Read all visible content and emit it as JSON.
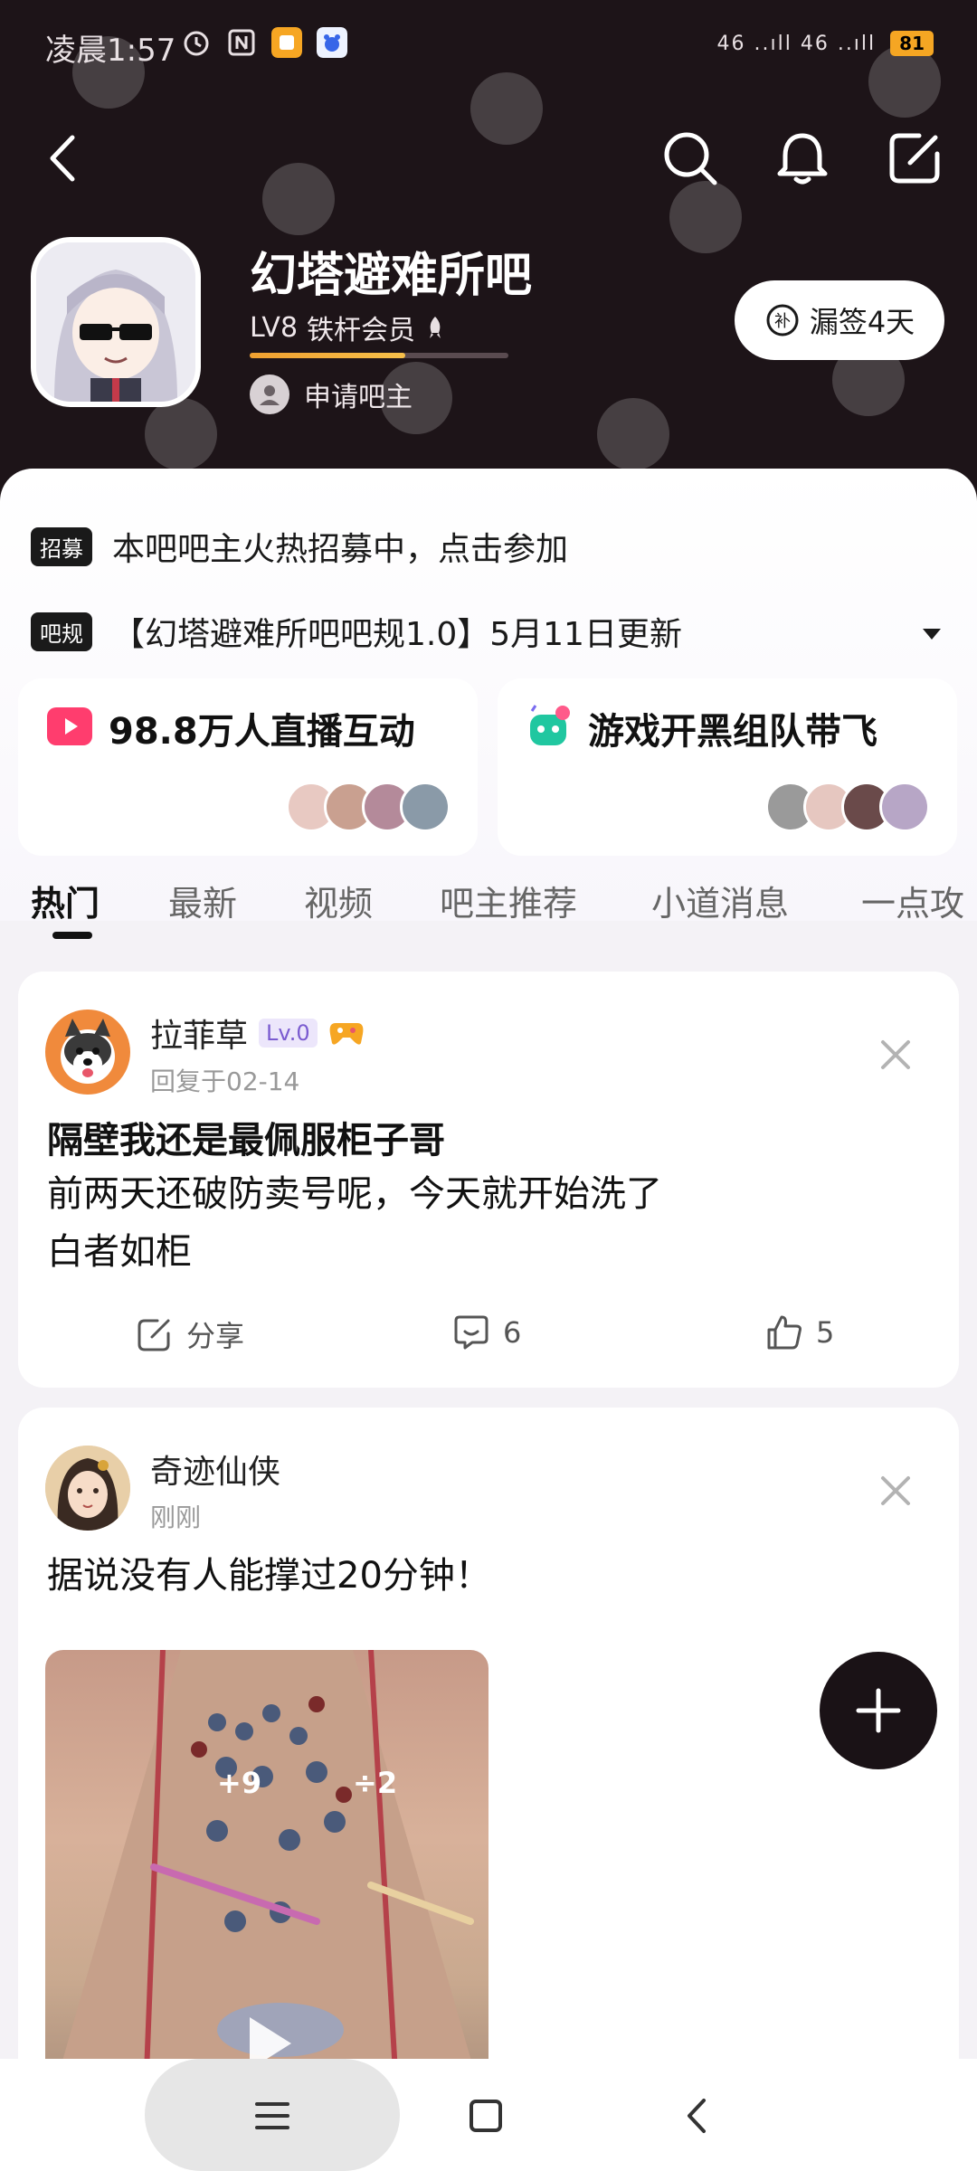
{
  "status_bar": {
    "time": "凌晨1:57",
    "signal": "46 ..ıll 46 ..ıll",
    "battery": "81"
  },
  "header": {
    "forum_name": "幻塔避难所吧",
    "level": "LV8",
    "member_title": "铁杆会员",
    "level_progress": 0.6,
    "apply_owner": "申请吧主",
    "signin_button": "漏签4天",
    "signin_icon_char": "补"
  },
  "notices": [
    {
      "tag": "招募",
      "text": "本吧吧主火热招募中，点击参加"
    },
    {
      "tag": "吧规",
      "text": "【幻塔避难所吧吧规1.0】5月11日更新"
    }
  ],
  "feature_cards": [
    {
      "title": "98.8万人直播互动"
    },
    {
      "title": "游戏开黑组队带飞"
    }
  ],
  "tabs": [
    "热门",
    "最新",
    "视频",
    "吧主推荐",
    "小道消息",
    "一点攻"
  ],
  "posts": [
    {
      "user": "拉菲草",
      "level": "Lv.0",
      "meta": "回复于02-14",
      "title": "隔壁我还是最佩服柜子哥",
      "body_line1": "前两天还破防卖号呢，今天就开始洗了",
      "body_line2": "白者如柜",
      "share_label": "分享",
      "comment_count": "6",
      "like_count": "5"
    },
    {
      "user": "奇迹仙侠",
      "meta": "刚刚",
      "text": "据说没有人能撑过20分钟！",
      "video_overlay_1": "+9",
      "video_overlay_2": "÷2"
    }
  ],
  "colors": {
    "header_bg": "#1d1418",
    "accent_live": "#ff3d6e",
    "accent_game": "#20c7a0",
    "level_bar": "#f0a030"
  }
}
